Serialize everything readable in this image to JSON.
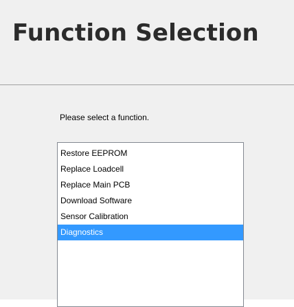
{
  "header": {
    "title": "Function Selection"
  },
  "main": {
    "instruction": "Please select a function.",
    "functions": [
      {
        "label": "Restore EEPROM",
        "selected": false
      },
      {
        "label": "Replace Loadcell",
        "selected": false
      },
      {
        "label": "Replace Main PCB",
        "selected": false
      },
      {
        "label": "Download Software",
        "selected": false
      },
      {
        "label": "Sensor Calibration",
        "selected": false
      },
      {
        "label": "Diagnostics",
        "selected": true
      }
    ]
  },
  "colors": {
    "selection": "#3399ff",
    "panel_background": "#f0f0f0"
  }
}
